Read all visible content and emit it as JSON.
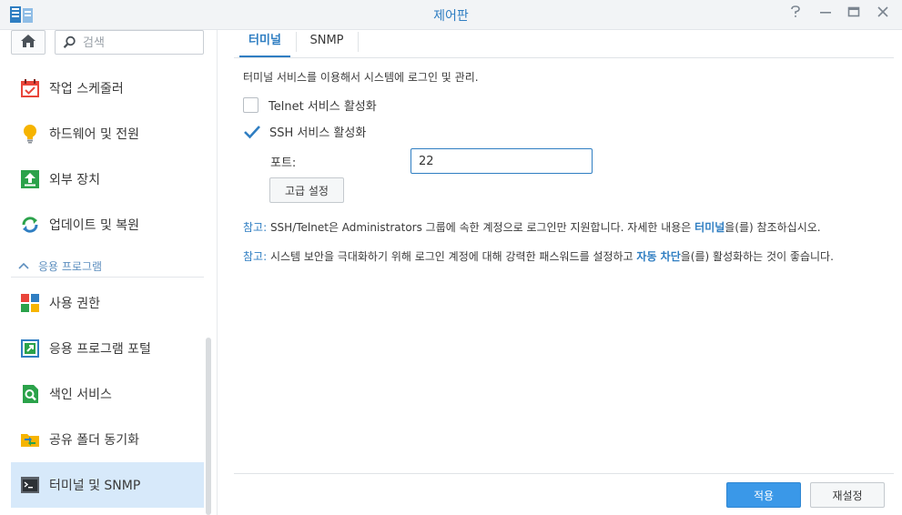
{
  "window": {
    "title": "제어판",
    "controls": [
      "help-icon",
      "minimize-icon",
      "maximize-icon",
      "close-icon"
    ]
  },
  "sidebar": {
    "search_placeholder": "검색",
    "items_top": [
      {
        "label": "작업 스케줄러",
        "icon": "calendar-icon"
      },
      {
        "label": "하드웨어 및 전원",
        "icon": "lightbulb-icon"
      },
      {
        "label": "외부 장치",
        "icon": "upload-icon"
      },
      {
        "label": "업데이트 및 복원",
        "icon": "refresh-icon"
      }
    ],
    "group_label": "응용 프로그램",
    "items_apps": [
      {
        "label": "사용 권한",
        "icon": "permissions-icon"
      },
      {
        "label": "응용 프로그램 포털",
        "icon": "portal-icon"
      },
      {
        "label": "색인 서비스",
        "icon": "search-service-icon"
      },
      {
        "label": "공유 폴더 동기화",
        "icon": "folder-sync-icon"
      },
      {
        "label": "터미널 및 SNMP",
        "icon": "terminal-icon",
        "active": true
      }
    ]
  },
  "tabs": [
    {
      "label": "터미널",
      "active": true
    },
    {
      "label": "SNMP",
      "active": false
    }
  ],
  "terminal": {
    "description": "터미널 서비스를 이용해서 시스템에 로그인 및 관리.",
    "telnet_label": "Telnet 서비스 활성화",
    "telnet_checked": false,
    "ssh_label": "SSH 서비스 활성화",
    "ssh_checked": true,
    "port_label": "포트:",
    "port_value": "22",
    "advanced_button": "고급 설정",
    "note1_label": "참고:",
    "note1_text_a": " SSH/Telnet은 Administrators 그룹에 속한 계정으로 로그인만 지원합니다. 자세한 내용은 ",
    "note1_link": "터미널",
    "note1_text_b": "을(를) 참조하십시오.",
    "note2_label": "참고:",
    "note2_text_a": " 시스템 보안을 극대화하기 위해 로그인 계정에 대해 강력한 패스워드를 설정하고 ",
    "note2_link": "자동 차단",
    "note2_text_b": "을(를) 활성화하는 것이 좋습니다."
  },
  "footer": {
    "apply": "적용",
    "reset": "재설정"
  },
  "colors": {
    "accent": "#2f7ec2",
    "active_bg": "#d7e9fa",
    "apply_bg": "#3a98e8"
  }
}
